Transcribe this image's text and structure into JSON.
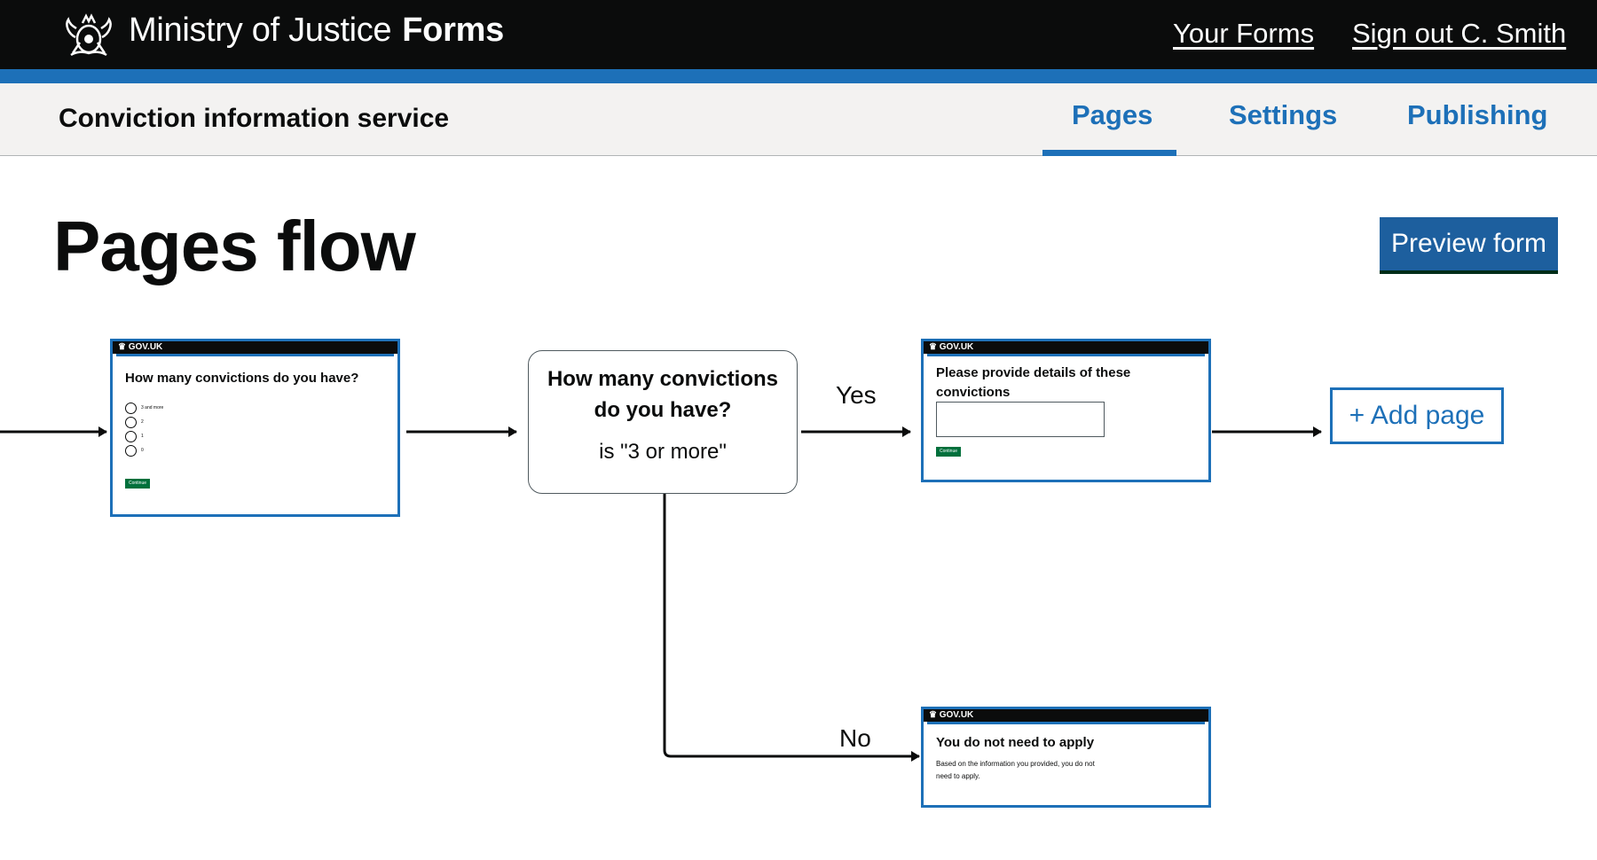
{
  "header": {
    "brand_prefix": "Ministry of Justice",
    "brand_product": "Forms",
    "your_forms_link": "Your Forms",
    "sign_out_link": "Sign out C. Smith"
  },
  "subnav": {
    "service_name": "Conviction information service",
    "tabs": [
      {
        "label": "Pages",
        "active": true
      },
      {
        "label": "Settings",
        "active": false
      },
      {
        "label": "Publishing",
        "active": false
      }
    ]
  },
  "main": {
    "title": "Pages flow",
    "preview_button": "Preview form"
  },
  "flow": {
    "card1": {
      "brand": "GOV.UK",
      "question": "How many convictions do you have?",
      "options": [
        "3 and more",
        "2",
        "1",
        "0"
      ],
      "button": "Continue"
    },
    "condition": {
      "question": "How many convictions do you have?",
      "value": "is \"3 or more\""
    },
    "branch_yes": "Yes",
    "branch_no": "No",
    "card_yes": {
      "brand": "GOV.UK",
      "question": "Please provide details of these convictions",
      "button": "Continue"
    },
    "card_no": {
      "brand": "GOV.UK",
      "heading": "You do not need to apply",
      "body": "Based on the information you provided, you do not need to apply."
    },
    "add_page_button": "+ Add page"
  },
  "colors": {
    "header_bg": "#0b0c0c",
    "accent_blue": "#1d70b8",
    "subnav_bg": "#f3f2f1",
    "button_green": "#00703c"
  }
}
